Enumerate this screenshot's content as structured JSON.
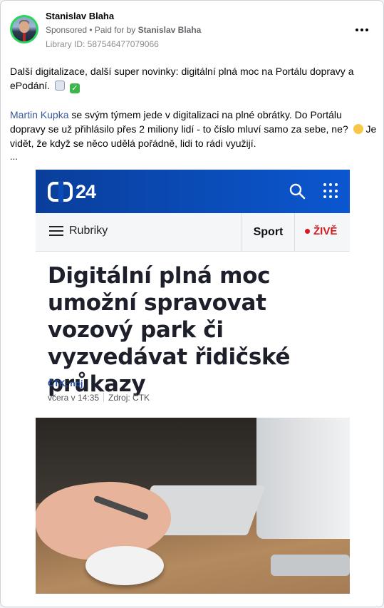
{
  "post": {
    "author": "Stanislav Blaha",
    "sponsored": "Sponsored",
    "paid_for_prefix": "• Paid for by",
    "paid_for": "Stanislav Blaha",
    "library_id": "Library ID: 587546477079066",
    "text_line1": "Další digitalizace, další super novinky: digitální plná moc na Portálu dopravy a ePodání.",
    "mention": "Martin Kupka",
    "text_line2": "se svým týmem jede v digitalizaci na plné obrátky. Do Portálu dopravy se už přihlásilo přes 2 miliony lidí - to číslo mluví samo za sebe, ne?",
    "text_line3": "Je vidět, že když se něco udělá pořádně, lidi to rádi využijí.",
    "ellipsis": "..."
  },
  "icons": {
    "more": "more-options-icon",
    "calendar": "calendar-emoji-icon",
    "check": "check-emoji-icon",
    "smile": "smile-emoji-icon"
  },
  "article": {
    "logo_number": "24",
    "menu_label": "Rubriky",
    "sport_label": "Sport",
    "live_label": "ŽIVĚ",
    "headline": "Digitální plná moc umožní spravovat vozový park či vyzvedávat řidičské průkazy",
    "authors": "ČTK, noj",
    "date": "včera v 14:35",
    "source": "Zdroj: ČTK"
  },
  "colors": {
    "brand_blue": "#0b57d0",
    "live_red": "#d71920",
    "link": "#385898"
  }
}
